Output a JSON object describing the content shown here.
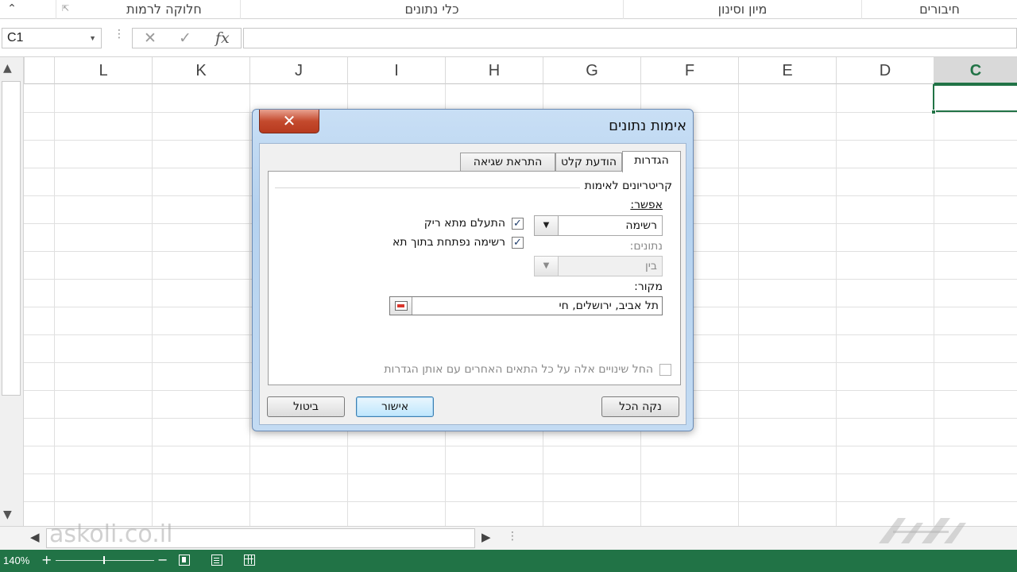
{
  "ribbon": {
    "collapse_icon": "chevron-up-icon",
    "groups": [
      "חיבורים",
      "מיון וסינון",
      "כלי נתונים",
      "חלוקה לרמות"
    ]
  },
  "formula_bar": {
    "name_box": "C1",
    "fx_label": "fx",
    "cancel_glyph": "✕",
    "enter_glyph": "✓",
    "formula_value": ""
  },
  "columns": [
    "L",
    "K",
    "J",
    "I",
    "H",
    "G",
    "F",
    "E",
    "D",
    "C"
  ],
  "selected_column": "C",
  "watermark": "askoli.co.il",
  "status_bar": {
    "zoom": "140%",
    "plus": "+",
    "minus": "−",
    "view_icons": [
      "page-layout-view-icon",
      "page-break-view-icon",
      "normal-view-icon"
    ]
  },
  "dialog": {
    "title": "אימות נתונים",
    "close_glyph": "✕",
    "tabs": [
      "הגדרות",
      "הודעת קלט",
      "התראת שגיאה"
    ],
    "active_tab": "הגדרות",
    "criteria_heading": "קריטריונים לאימות",
    "allow_label": "אפשר:",
    "allow_value": "רשימה",
    "data_label": "נתונים:",
    "data_value": "בין",
    "source_label": "מקור:",
    "source_value": "תל אביב, ירושלים, חי",
    "ignore_blank_label": "התעלם מתא ריק",
    "ignore_blank_checked": true,
    "incell_dropdown_label": "רשימה נפתחת בתוך תא",
    "incell_dropdown_checked": true,
    "apply_all_label": "החל שינויים אלה על כל התאים האחרים עם אותן הגדרות",
    "apply_all_checked": false,
    "clear_all_button": "נקה הכל",
    "ok_button": "אישור",
    "cancel_button": "ביטול",
    "check_glyph": "✓"
  }
}
